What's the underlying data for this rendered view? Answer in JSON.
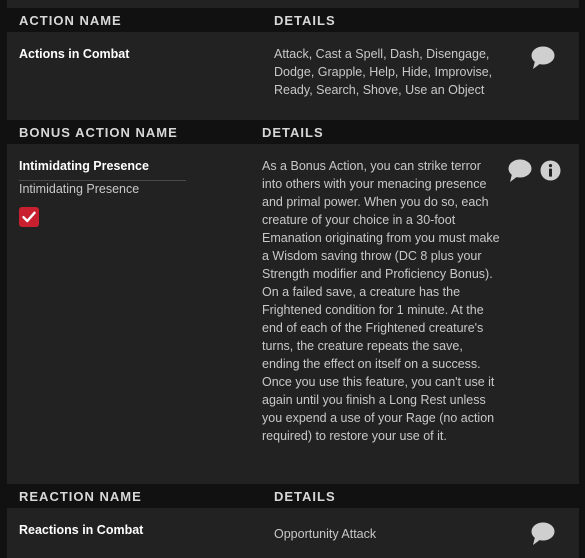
{
  "actions": {
    "header_name": "ACTION NAME",
    "header_details": "DETAILS",
    "title": "Actions in Combat",
    "details": "Attack, Cast a Spell, Dash, Disengage, Dodge, Grapple, Help, Hide, Improvise, Ready, Search, Shove, Use an Object",
    "icon": "speech-bubble-icon"
  },
  "bonus_actions": {
    "header_name": "BONUS ACTION NAME",
    "header_details": "DETAILS",
    "title": "Intimidating Presence",
    "subtitle": "Intimidating Presence",
    "checkbox_checked": true,
    "details_p1": "As a Bonus Action, you can strike terror into others with your menacing presence and primal power. When you do so, each creature of your choice in a 30-foot Emanation originating from you must make a Wisdom saving throw (DC 8 plus your Strength modifier and Proficiency Bonus). On a failed save, a creature has the Frightened condition for 1 minute. At the end of each of the Frightened creature's turns, the creature repeats the save, ending the effect on itself on a success.",
    "details_p2": "Once you use this feature, you can't use it again until you finish a Long Rest unless you expend a use of your Rage (no action required) to restore your use of it.",
    "icons": [
      "speech-bubble-icon",
      "info-icon"
    ]
  },
  "reactions": {
    "header_name": "REACTION NAME",
    "header_details": "DETAILS",
    "title": "Reactions in Combat",
    "details": "Opportunity Attack",
    "icon": "speech-bubble-icon"
  },
  "colors": {
    "panel_bg": "#222222",
    "header_bg": "#111111",
    "checkbox": "#c8202e",
    "icon": "#cfcfcf"
  }
}
